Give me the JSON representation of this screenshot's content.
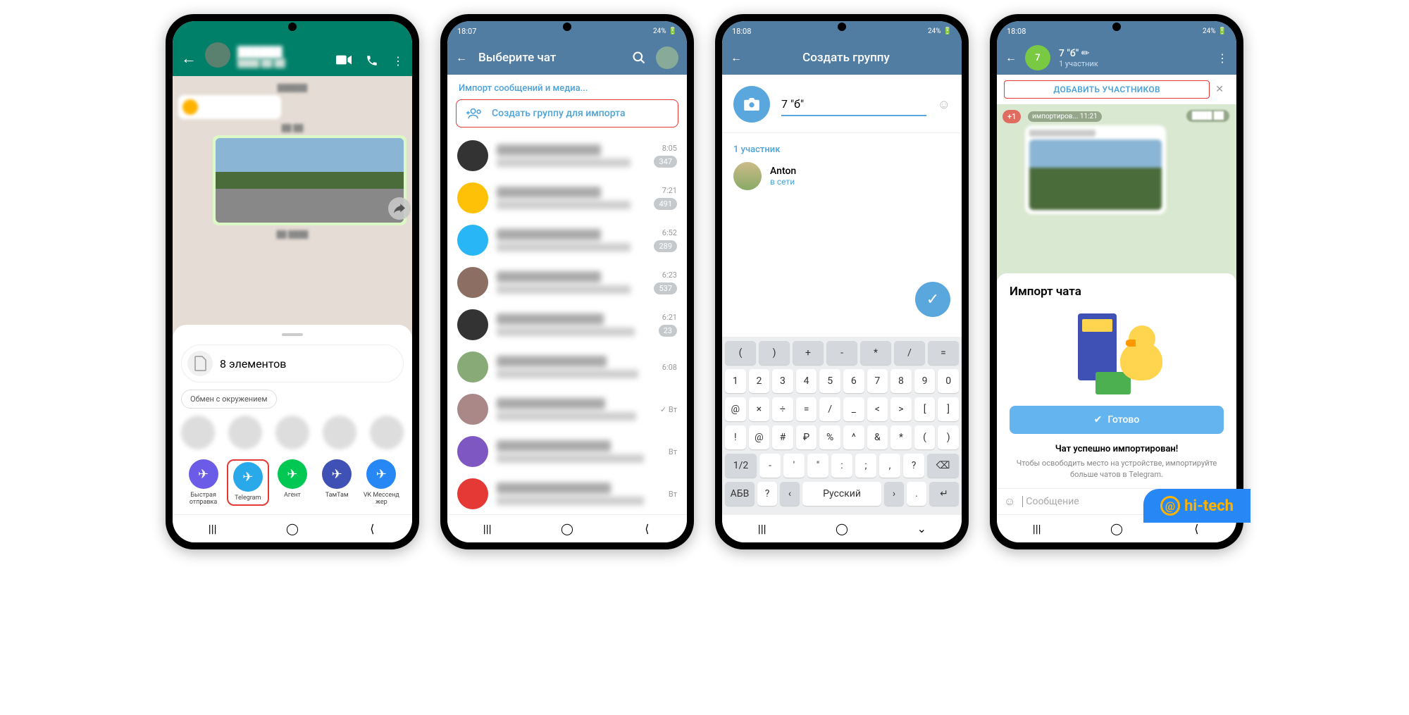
{
  "status": {
    "time1": "18:07",
    "time2": "18:08",
    "battery": "24%",
    "icons_left": "◢ ▭ ▬ ▯",
    "icons_right": "⇅ ◉ ▾ ◢"
  },
  "phone1": {
    "share_sheet": {
      "items_label": "8 элементов",
      "nearby_label": "Обмен с окружением",
      "apps": [
        {
          "label": "Быстрая отправка",
          "color": "#6b5ce7"
        },
        {
          "label": "Telegram",
          "color": "#29a9ea",
          "highlighted": true
        },
        {
          "label": "Агент",
          "color": "#00c853"
        },
        {
          "label": "ТамТам",
          "color": "#3f51b5"
        },
        {
          "label": "VK Мессенд жер",
          "color": "#2787f5"
        }
      ]
    }
  },
  "phone2": {
    "header_title": "Выберите чат",
    "section_label": "Импорт сообщений и медиа...",
    "create_group_label": "Создать группу для импорта",
    "chats": [
      {
        "time": "8:05",
        "badge": "347",
        "color": "#333"
      },
      {
        "time": "7:21",
        "badge": "491",
        "color": "#ffc107"
      },
      {
        "time": "6:52",
        "badge": "289",
        "color": "#29b6f6"
      },
      {
        "time": "6:23",
        "badge": "537",
        "color": "#8d6e63"
      },
      {
        "time": "6:21",
        "badge": "23",
        "color": "#333"
      },
      {
        "time": "6:08",
        "badge": "",
        "color": "#8a7"
      },
      {
        "time": "✓ Вт",
        "badge": "",
        "color": "#a88"
      },
      {
        "time": "Вт",
        "badge": "",
        "color": "#7e57c2"
      },
      {
        "time": "Вт",
        "badge": "",
        "color": "#e53935"
      }
    ]
  },
  "phone3": {
    "header_title": "Создать группу",
    "group_name_value": "7 \"б\"",
    "members_label": "1 участник",
    "member_name": "Anton",
    "member_status": "в сети",
    "keyboard": {
      "row0": [
        "(",
        ")",
        "+",
        "-",
        "*",
        "/",
        "="
      ],
      "row1": [
        "1",
        "2",
        "3",
        "4",
        "5",
        "6",
        "7",
        "8",
        "9",
        "0"
      ],
      "row2": [
        "@",
        "×",
        "÷",
        "=",
        "/",
        "_",
        "<",
        ">",
        "[",
        "]"
      ],
      "row3": [
        "!",
        "@",
        "#",
        "₽",
        "%",
        "^",
        "&",
        "*",
        "(",
        ")"
      ],
      "row4_shift": "1/2",
      "row4": [
        "-",
        "'",
        "\"",
        ":",
        ";",
        ",",
        "?"
      ],
      "row4_del": "⌫",
      "row5_abc": "АБВ",
      "row5_q": "?",
      "row5_lang": "Русский",
      "row5_dot": ".",
      "row5_enter": "↵"
    }
  },
  "phone4": {
    "group_avatar_initial": "7",
    "group_title": "7 \"б\" ✏",
    "group_sub": "1 участник",
    "add_members": "ДОБАВИТЬ УЧАСТНИКОВ",
    "new_badge": "+1",
    "import_time_label": "импортиров... 11:21",
    "panel_title": "Импорт чата",
    "done_button": "Готово",
    "success_title": "Чат успешно импортирован!",
    "success_sub": "Чтобы освободить место на устройстве, импортируйте больше чатов в Telegram.",
    "input_placeholder": "Сообщение"
  },
  "watermark": "hi-tech"
}
